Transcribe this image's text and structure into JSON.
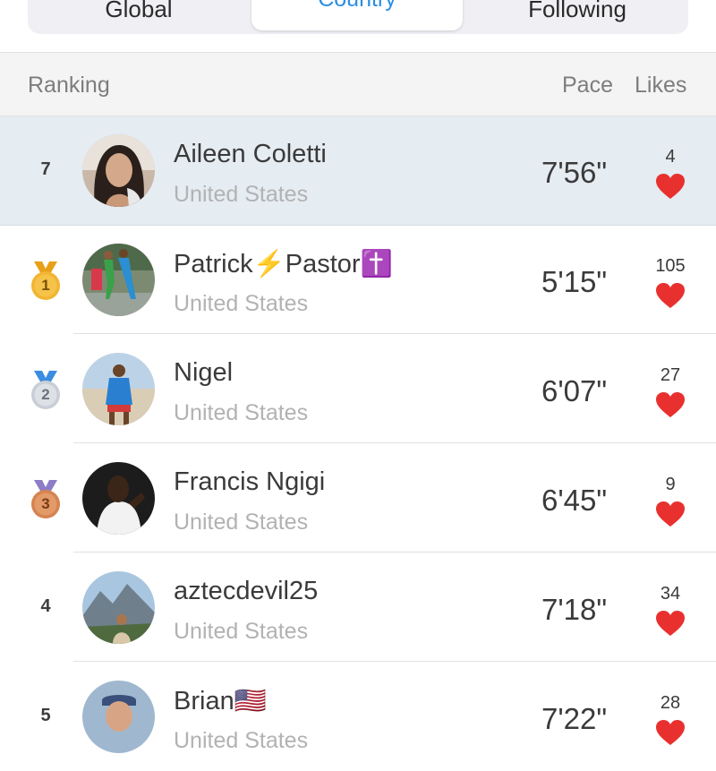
{
  "tabs": {
    "global": "Global",
    "country": "Country",
    "following": "Following"
  },
  "header": {
    "ranking": "Ranking",
    "pace": "Pace",
    "likes": "Likes"
  },
  "colors": {
    "accent": "#2a8ee6",
    "heart": "#e8312f",
    "highlight_row": "#e5ecf2"
  },
  "rows": [
    {
      "rank": "7",
      "name": "Aileen Coletti",
      "country": "United States",
      "pace": "7'56\"",
      "likes": "4",
      "highlight": true
    },
    {
      "rank": "1",
      "medal": "gold",
      "name": "Patrick⚡Pastor✝️",
      "country": "United States",
      "pace": "5'15\"",
      "likes": "105"
    },
    {
      "rank": "2",
      "medal": "silver",
      "name": "Nigel",
      "country": "United States",
      "pace": "6'07\"",
      "likes": "27"
    },
    {
      "rank": "3",
      "medal": "bronze",
      "name": "Francis Ngigi",
      "country": "United States",
      "pace": "6'45\"",
      "likes": "9"
    },
    {
      "rank": "4",
      "name": "aztecdevil25",
      "country": "United States",
      "pace": "7'18\"",
      "likes": "34"
    },
    {
      "rank": "5",
      "name": "Brian🇺🇸",
      "country": "United States",
      "pace": "7'22\"",
      "likes": "28"
    }
  ]
}
